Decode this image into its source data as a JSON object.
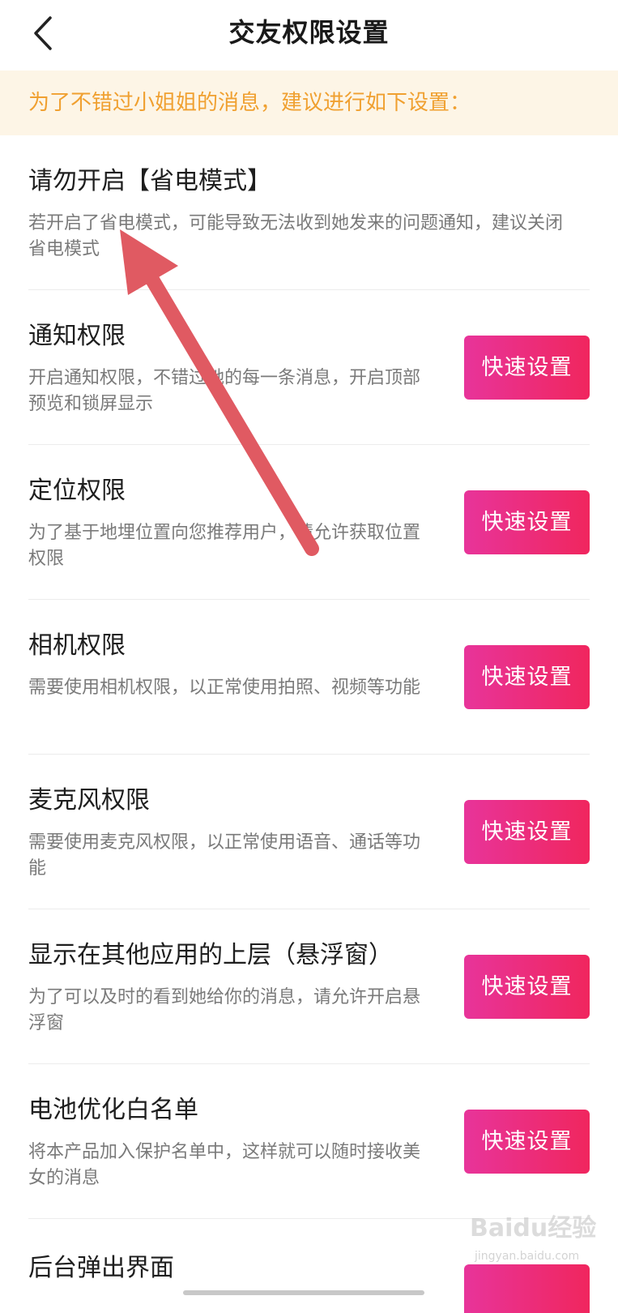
{
  "header": {
    "title": "交友权限设置"
  },
  "tip": "为了不错过小姐姐的消息，建议进行如下设置：",
  "items": [
    {
      "title": "请勿开启【省电模式】",
      "desc": "若开启了省电模式，可能导致无法收到她发来的问题通知，建议关闭省电模式"
    },
    {
      "title": "通知权限",
      "desc": "开启通知权限，不错过她的每一条消息，开启顶部预览和锁屏显示",
      "button": "快速设置"
    },
    {
      "title": "定位权限",
      "desc": "为了基于地埋位置向您推荐用户，请允许获取位置权限",
      "button": "快速设置"
    },
    {
      "title": "相机权限",
      "desc": "需要使用相机权限，以正常使用拍照、视频等功能",
      "button": "快速设置"
    },
    {
      "title": "麦克风权限",
      "desc": "需要使用麦克风权限，以正常使用语音、通话等功能",
      "button": "快速设置"
    },
    {
      "title": "显示在其他应用的上层（悬浮窗）",
      "desc": "为了可以及时的看到她给你的消息，请允许开启悬浮窗",
      "button": "快速设置"
    },
    {
      "title": "电池优化白名单",
      "desc": "将本产品加入保护名单中，这样就可以随时接收美女的消息",
      "button": "快速设置"
    },
    {
      "title": "后台弹出界面",
      "button": ""
    }
  ],
  "watermark": {
    "logo": "Baidu经验",
    "url": "jingyan.baidu.com"
  },
  "colors": {
    "accent_start": "#e8349a",
    "accent_end": "#f0265e",
    "tip_text": "#f0a030",
    "tip_bg": "#fdf5e6",
    "arrow": "#e05a62"
  }
}
